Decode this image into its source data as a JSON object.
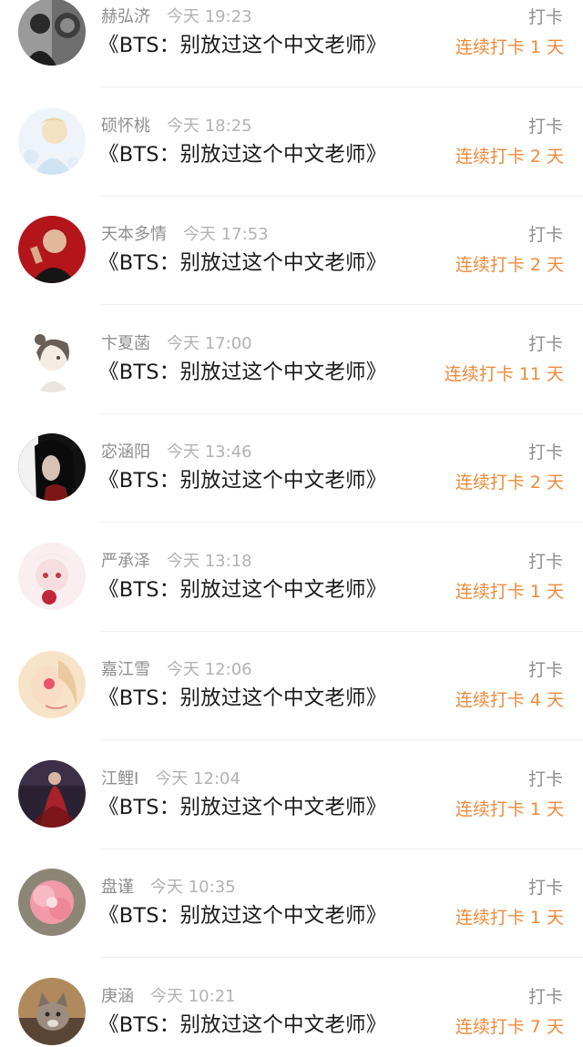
{
  "feed": {
    "items": [
      {
        "username": "赫弘济",
        "time": "今天 19:23",
        "title": "《BTS：别放过这个中文老师》",
        "action": "打卡",
        "streak": "连续打卡 1 天",
        "avatar": "avatar-dark-portrait"
      },
      {
        "username": "硕怀桃",
        "time": "今天 18:25",
        "title": "《BTS：别放过这个中文老师》",
        "action": "打卡",
        "streak": "连续打卡 2 天",
        "avatar": "avatar-pastel-illustration"
      },
      {
        "username": "天本多情",
        "time": "今天 17:53",
        "title": "《BTS：别放过这个中文老师》",
        "action": "打卡",
        "streak": "连续打卡 2 天",
        "avatar": "avatar-red-portrait"
      },
      {
        "username": "卞夏菡",
        "time": "今天 17:00",
        "title": "《BTS：别放过这个中文老师》",
        "action": "打卡",
        "streak": "连续打卡 11 天",
        "avatar": "avatar-sketch-girl"
      },
      {
        "username": "宓涵阳",
        "time": "今天 13:46",
        "title": "《BTS：别放过这个中文老师》",
        "action": "打卡",
        "streak": "连续打卡 2 天",
        "avatar": "avatar-dark-hair"
      },
      {
        "username": "严承泽",
        "time": "今天 13:18",
        "title": "《BTS：别放过这个中文老师》",
        "action": "打卡",
        "streak": "连续打卡 1 天",
        "avatar": "avatar-pink-doll"
      },
      {
        "username": "嘉江雪",
        "time": "今天 12:06",
        "title": "《BTS：别放过这个中文老师》",
        "action": "打卡",
        "streak": "连续打卡 4 天",
        "avatar": "avatar-peach-illustration"
      },
      {
        "username": "江鲤Ⅰ",
        "time": "今天 12:04",
        "title": "《BTS：别放过这个中文老师》",
        "action": "打卡",
        "streak": "连续打卡 1 天",
        "avatar": "avatar-red-dress"
      },
      {
        "username": "盘谨",
        "time": "今天 10:35",
        "title": "《BTS：别放过这个中文老师》",
        "action": "打卡",
        "streak": "连续打卡 1 天",
        "avatar": "avatar-pink-flower"
      },
      {
        "username": "庚涵",
        "time": "今天 10:21",
        "title": "《BTS：别放过这个中文老师》",
        "action": "打卡",
        "streak": "连续打卡 7 天",
        "avatar": "avatar-cat"
      }
    ]
  },
  "colors": {
    "streak": "#f08a3a",
    "username": "#8e8e8e",
    "time": "#b2b2b2",
    "title": "#1a1a1a",
    "divider": "#efefef"
  }
}
